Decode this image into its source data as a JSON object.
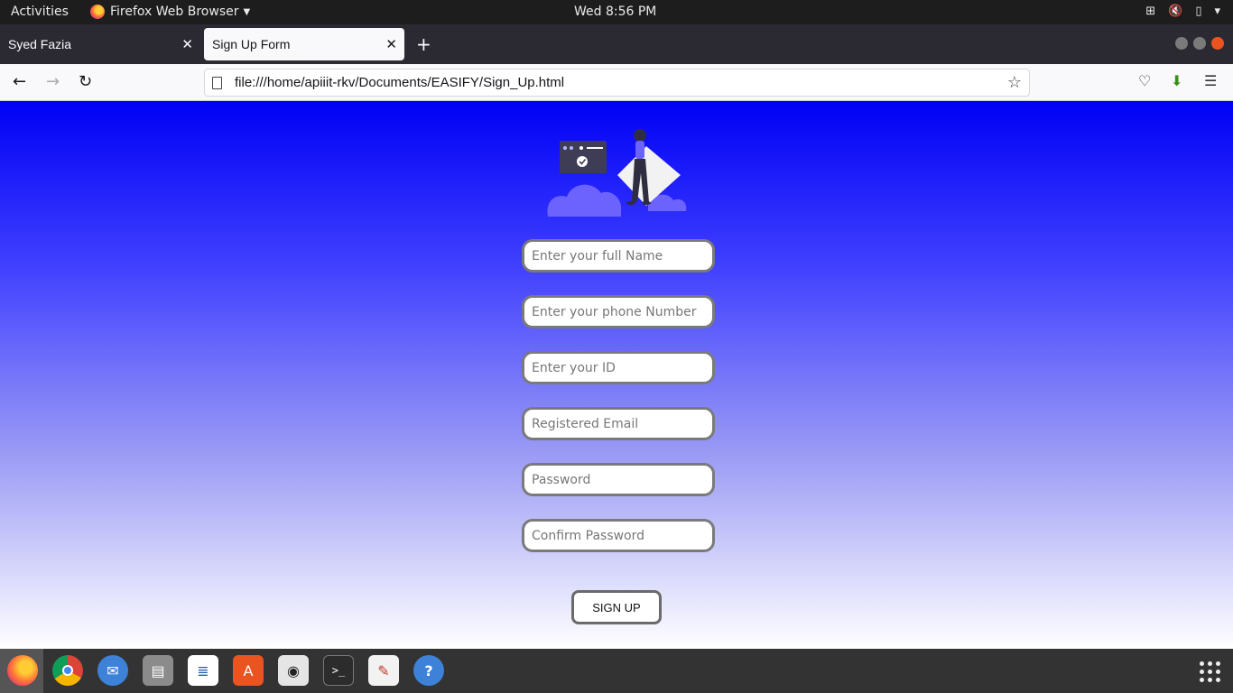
{
  "topbar": {
    "activities": "Activities",
    "app_name": "Firefox Web Browser",
    "clock": "Wed  8:56 PM"
  },
  "tabs": [
    {
      "label": "Syed Fazia"
    },
    {
      "label": "Sign Up Form"
    }
  ],
  "navbar": {
    "url": "file:///home/apiiit-rkv/Documents/EASIFY/Sign_Up.html"
  },
  "form": {
    "fields": [
      {
        "placeholder": "Enter your full Name"
      },
      {
        "placeholder": "Enter your phone Number"
      },
      {
        "placeholder": "Enter your ID"
      },
      {
        "placeholder": "Registered Email"
      },
      {
        "placeholder": "Password"
      },
      {
        "placeholder": "Confirm Password"
      }
    ],
    "submit_label": "SIGN UP"
  },
  "colors": {
    "gradient_top": "#0000f5",
    "gradient_bottom": "#ffffff",
    "illustration_accent": "#6c63ff"
  },
  "dock": {
    "icons": [
      "firefox-icon",
      "chrome-icon",
      "thunderbird-icon",
      "files-icon",
      "writer-icon",
      "software-icon",
      "rhythmbox-icon",
      "terminal-icon",
      "text-editor-icon",
      "help-icon",
      "show-apps-icon"
    ]
  }
}
